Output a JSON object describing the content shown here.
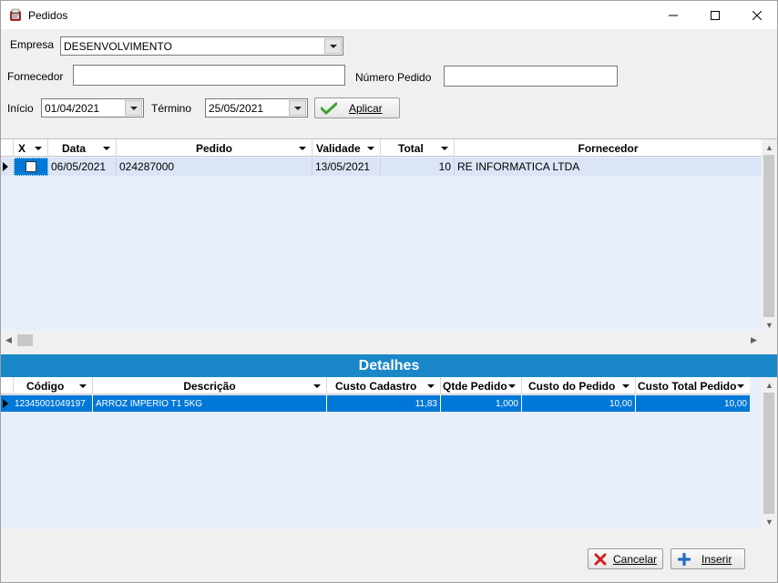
{
  "window": {
    "title": "Pedidos",
    "minimize_glyph": "—",
    "maximize_glyph": "☐",
    "close_glyph": "✕"
  },
  "form": {
    "empresa_label": "Empresa",
    "empresa_value": "DESENVOLVIMENTO",
    "fornecedor_label": "Fornecedor",
    "fornecedor_value": "",
    "numero_pedido_label": "Número Pedido",
    "numero_pedido_value": "",
    "inicio_label": "Início",
    "inicio_value": "01/04/2021",
    "termino_label": "Término",
    "termino_value": "25/05/2021",
    "aplicar_label": "Aplicar"
  },
  "pedidos_grid": {
    "columns": [
      "X",
      "Data",
      "Pedido",
      "Validade",
      "Total",
      "Fornecedor"
    ],
    "rows": [
      {
        "x": "",
        "data": "06/05/2021",
        "pedido": "024287000",
        "validade": "13/05/2021",
        "total": "10",
        "fornecedor": "RE INFORMATICA LTDA"
      }
    ]
  },
  "detalhes": {
    "title": "Detalhes",
    "columns": [
      "Código",
      "Descrição",
      "Custo Cadastro",
      "Qtde Pedido",
      "Custo do Pedido",
      "Custo Total Pedido"
    ],
    "rows": [
      {
        "codigo": "12345001049197",
        "descricao": "ARROZ IMPERIO T1 5KG",
        "custo_cadastro": "11,83",
        "qtde_pedido": "1,000",
        "custo_pedido": "10,00",
        "custo_total": "10,00"
      }
    ]
  },
  "footer": {
    "cancelar_label": "Cancelar",
    "inserir_label": "Inserir"
  },
  "colors": {
    "accent": "#1a87c9",
    "selected_row": "#0078d7",
    "grid_bg": "#e9effa"
  }
}
